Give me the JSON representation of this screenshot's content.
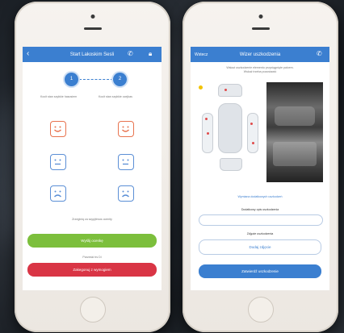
{
  "left_phone": {
    "navbar": {
      "title": "Start Lakoskim Sesli",
      "back_icon": "chevron-left-icon",
      "phone_icon": "phone-icon",
      "lock_icon": "lock-icon"
    },
    "stepper": {
      "step1": "1",
      "step2": "2",
      "label1": "Kocit stan szybkie hasosiem",
      "label2": "Kocit stan szybkie ocejkas"
    },
    "ratings": {
      "left_column": [
        "happy",
        "neutral",
        "sad"
      ],
      "right_column": [
        "happy",
        "neutral",
        "sad"
      ]
    },
    "notice": "Zrzeginiq za szypjitmos ocenity",
    "primary_button": "Wyślij ocenkę",
    "secondary_caption": "Parzeski trs Di",
    "danger_button": "Zakegonuj z wymogiem"
  },
  "right_phone": {
    "navbar": {
      "title": "Wizer uszkodzenia",
      "back_label": "Wstecz",
      "phone_icon": "phone-icon"
    },
    "header_text_1": "Wskaż uszkodzenie elementu przyciągnięte palcem.",
    "header_text_2": "Wskaż trzeba pozostawić",
    "link_text": "Wymiana dodatkowych uszkodzeń",
    "section1_label": "Dodatkowy opis uszkodzenia",
    "input1_placeholder": "",
    "section2_label": "Zdjęcie uszkodzenia",
    "photo_button": "Dodaj zdjęcie",
    "submit_button": "Zatwierdź uszkodzenie"
  },
  "colors": {
    "brand_blue": "#3b7fd0",
    "green": "#7cbf3c",
    "red": "#d93545",
    "happy": "#e8734f",
    "neutral": "#5b8fd6",
    "sad": "#5b8fd6"
  }
}
